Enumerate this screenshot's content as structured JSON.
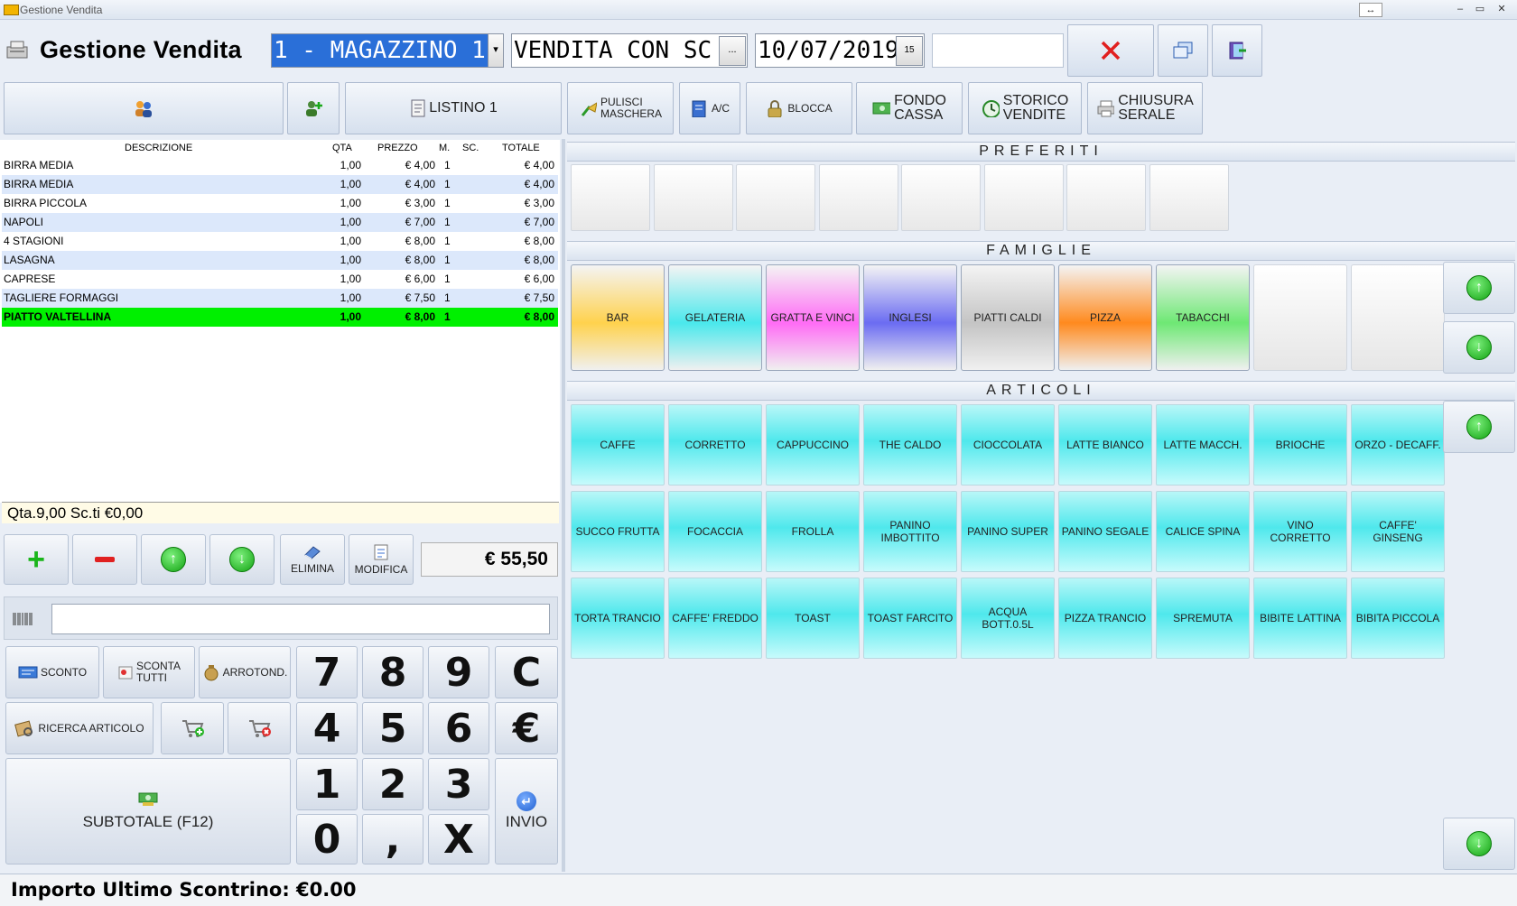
{
  "window": {
    "title": "Gestione Vendita"
  },
  "header": {
    "title": "Gestione Vendita",
    "warehouse": "1 - MAGAZZINO 1",
    "sale_type": "VENDITA CON SC",
    "sale_type_btn": "...",
    "date": "10/07/2019",
    "date_btn": "15",
    "close_icon": "red-x-icon"
  },
  "toolbar": {
    "listino_label": "LISTINO 1",
    "pulisci_label": "PULISCI\nMASCHERA",
    "ac_label": "A/C",
    "blocca_label": "BLOCCA",
    "fondo_label": "FONDO\nCASSA",
    "storico_label": "STORICO\nVENDITE",
    "chiusura_label": "CHIUSURA\nSERALE"
  },
  "list": {
    "headers": {
      "descrizione": "DESCRIZIONE",
      "qta": "QTA",
      "prezzo": "PREZZO",
      "m": "M.",
      "sc": "SC.",
      "totale": "TOTALE"
    },
    "rows": [
      {
        "desc": "BIRRA MEDIA",
        "qta": "1,00",
        "prezzo": "€ 4,00",
        "m": "1",
        "totale": "€ 4,00"
      },
      {
        "desc": "BIRRA MEDIA",
        "qta": "1,00",
        "prezzo": "€ 4,00",
        "m": "1",
        "totale": "€ 4,00"
      },
      {
        "desc": "BIRRA PICCOLA",
        "qta": "1,00",
        "prezzo": "€ 3,00",
        "m": "1",
        "totale": "€ 3,00"
      },
      {
        "desc": "NAPOLI",
        "qta": "1,00",
        "prezzo": "€ 7,00",
        "m": "1",
        "totale": "€ 7,00"
      },
      {
        "desc": "4 STAGIONI",
        "qta": "1,00",
        "prezzo": "€ 8,00",
        "m": "1",
        "totale": "€ 8,00"
      },
      {
        "desc": "LASAGNA",
        "qta": "1,00",
        "prezzo": "€ 8,00",
        "m": "1",
        "totale": "€ 8,00"
      },
      {
        "desc": "CAPRESE",
        "qta": "1,00",
        "prezzo": "€ 6,00",
        "m": "1",
        "totale": "€ 6,00"
      },
      {
        "desc": "TAGLIERE FORMAGGI",
        "qta": "1,00",
        "prezzo": "€ 7,50",
        "m": "1",
        "totale": "€ 7,50"
      },
      {
        "desc": "PIATTO VALTELLINA",
        "qta": "1,00",
        "prezzo": "€ 8,00",
        "m": "1",
        "totale": "€ 8,00"
      }
    ],
    "summary": "Qta.9,00 Sc.ti €0,00"
  },
  "controls": {
    "elimina": "ELIMINA",
    "modifica": "MODIFICA",
    "total": "€ 55,50",
    "sconto": "SCONTO",
    "sconta_tutti": "SCONTA\nTUTTI",
    "arrotond": "ARROTOND.",
    "ricerca": "RICERCA ARTICOLO",
    "subtotale": "SUBTOTALE (F12)",
    "invio": "INVIO",
    "keys": {
      "k7": "7",
      "k8": "8",
      "k9": "9",
      "kc": "C",
      "k4": "4",
      "k5": "5",
      "k6": "6",
      "keur": "€",
      "k1": "1",
      "k2": "2",
      "k3": "3",
      "k0": "0",
      "kcomma": ",",
      "kx": "X"
    }
  },
  "preferiti": {
    "title": "PREFERITI"
  },
  "famiglie": {
    "title": "FAMIGLIE",
    "items": [
      {
        "label": "BAR",
        "color": "#ffd24d"
      },
      {
        "label": "GELATERIA",
        "color": "#4ae8ec"
      },
      {
        "label": "GRATTA E VINCI",
        "color": "#ff6cf5"
      },
      {
        "label": "INGLESI",
        "color": "#6b6cf2"
      },
      {
        "label": "PIATTI CALDI",
        "color": "#c4c4c4"
      },
      {
        "label": "PIZZA",
        "color": "#ff8a1e"
      },
      {
        "label": "TABACCHI",
        "color": "#6ee874"
      }
    ]
  },
  "articoli": {
    "title": "ARTICOLI",
    "items": [
      "CAFFE",
      "CORRETTO",
      "CAPPUCCINO",
      "THE  CALDO",
      "CIOCCOLATA",
      "LATTE BIANCO",
      "LATTE MACCH.",
      "BRIOCHE",
      "ORZO - DECAFF.",
      "SUCCO FRUTTA",
      "FOCACCIA",
      "FROLLA",
      "PANINO\nIMBOTTITO",
      "PANINO SUPER",
      "PANINO SEGALE",
      "CALICE SPINA",
      "VINO\nCORRETTO",
      "CAFFE'\nGINSENG",
      "TORTA TRANCIO",
      "CAFFE' FREDDO",
      "TOAST",
      "TOAST FARCITO",
      "ACQUA\nBOTT.0.5L",
      "PIZZA TRANCIO",
      "SPREMUTA",
      "BIBITE LATTINA",
      "BIBITA PICCOLA"
    ]
  },
  "status": {
    "last_receipt": "Importo Ultimo Scontrino: €0.00"
  }
}
